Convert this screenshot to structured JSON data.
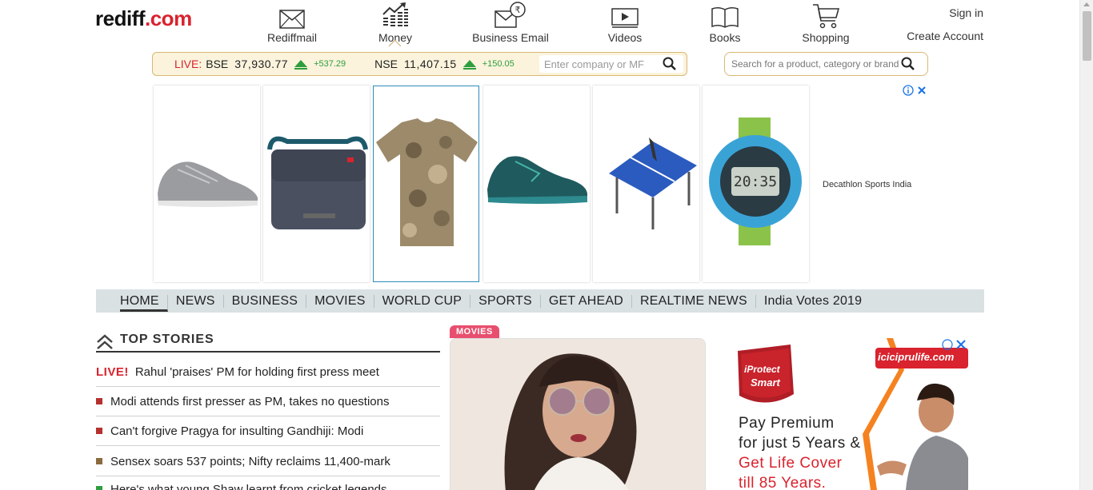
{
  "brand": {
    "name": "rediff",
    "suffix": ".com",
    "accent": "#d9232e"
  },
  "topnav": [
    {
      "label": "Rediffmail",
      "icon": "mail-icon"
    },
    {
      "label": "Money",
      "icon": "money-chart-icon"
    },
    {
      "label": "Business Email",
      "icon": "business-email-icon"
    },
    {
      "label": "Videos",
      "icon": "video-icon"
    },
    {
      "label": "Books",
      "icon": "book-icon"
    },
    {
      "label": "Shopping",
      "icon": "cart-icon"
    }
  ],
  "account": {
    "signin": "Sign in",
    "create": "Create Account"
  },
  "ticker": {
    "live": "LIVE:",
    "bse_label": "BSE",
    "bse_value": "37,930.77",
    "bse_change": "+537.29",
    "nse_label": "NSE",
    "nse_value": "11,407.15",
    "nse_change": "+150.05",
    "search_placeholder": "Enter company or MF",
    "up_color": "#2e9e3e"
  },
  "shop_search": {
    "placeholder": "Search for a product, category or brand"
  },
  "ad_strip": {
    "sponsor": "Decathlon Sports India",
    "products": [
      "shoe-grey",
      "messenger-bag",
      "camo-tshirt",
      "running-shoe-teal",
      "table-tennis-table",
      "sports-watch"
    ]
  },
  "mainnav": [
    "HOME",
    "NEWS",
    "BUSINESS",
    "MOVIES",
    "WORLD CUP",
    "SPORTS",
    "GET AHEAD",
    "REALTIME NEWS",
    "India Votes 2019"
  ],
  "top_stories": {
    "title": "TOP STORIES",
    "items": [
      {
        "tag": "LIVE!",
        "text": "Rahul 'praises' PM for holding first press meet",
        "bullet": ""
      },
      {
        "tag": "",
        "text": "Modi attends first presser as PM, takes no questions",
        "bullet": "#b5302f"
      },
      {
        "tag": "",
        "text": "Can't forgive Pragya for insulting Gandhiji: Modi",
        "bullet": "#b5302f"
      },
      {
        "tag": "",
        "text": "Sensex soars 537 points; Nifty reclaims 11,400-mark",
        "bullet": "#8b6a3e"
      },
      {
        "tag": "",
        "text": "Here's what young Shaw learnt from cricket legends",
        "bullet": "#2e9e3e"
      }
    ]
  },
  "movies": {
    "tag": "MOVIES"
  },
  "right_ad": {
    "brand": "iciciprulife.com",
    "product_line1": "iProtect",
    "product_line2": "Smart",
    "line1": "Pay Premium",
    "line2": "for just 5 Years &",
    "line3": "Get Life Cover",
    "line4": "till 85 Years."
  }
}
